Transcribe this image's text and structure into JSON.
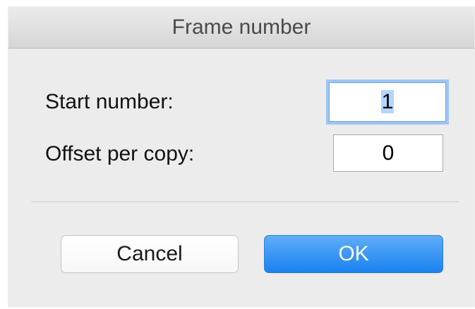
{
  "dialog": {
    "title": "Frame number",
    "start_number": {
      "label": "Start number:",
      "value": "1"
    },
    "offset_per_copy": {
      "label": "Offset per copy:",
      "value": "0"
    },
    "buttons": {
      "cancel": "Cancel",
      "ok": "OK"
    }
  },
  "colors": {
    "accent": "#1a82f0",
    "focus_ring": "#9cc5f2",
    "selection": "#b4d5fe"
  }
}
